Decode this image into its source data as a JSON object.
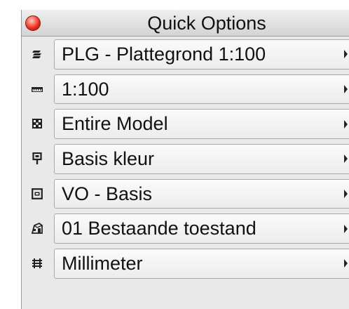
{
  "window": {
    "title": "Quick Options",
    "close_color": "#e0281a"
  },
  "rows": [
    {
      "icon": "layer-stack-icon",
      "label": "PLG - Plattegrond 1:100"
    },
    {
      "icon": "ruler-scale-icon",
      "label": "1:100"
    },
    {
      "icon": "model-grid-icon",
      "label": "Entire Model"
    },
    {
      "icon": "pen-pin-icon",
      "label": "Basis kleur"
    },
    {
      "icon": "frame-icon",
      "label": "VO - Basis"
    },
    {
      "icon": "building-icon",
      "label": "01 Bestaande toestand"
    },
    {
      "icon": "dimension-lines-icon",
      "label": "Millimeter"
    }
  ]
}
